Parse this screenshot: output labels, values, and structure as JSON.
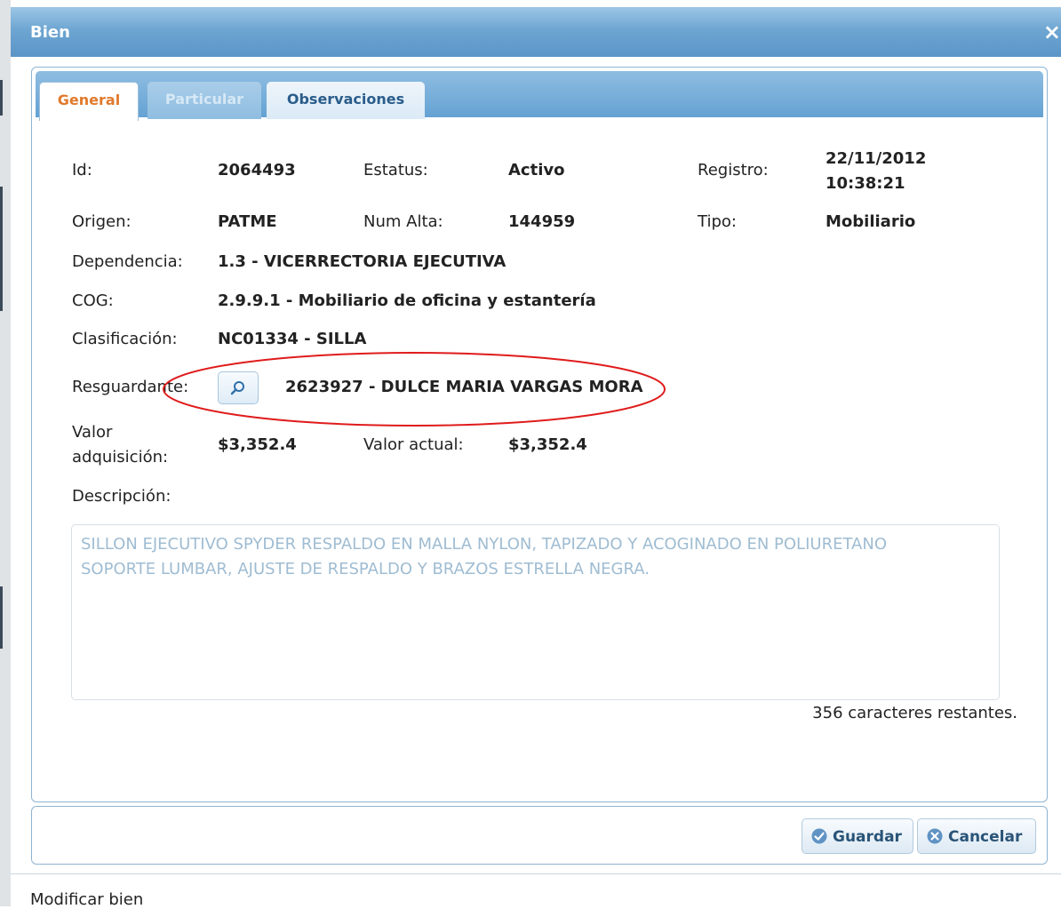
{
  "dialog": {
    "title": "Bien",
    "close_symbol": "×"
  },
  "tabs": [
    {
      "label": "General",
      "active": true
    },
    {
      "label": "Particular",
      "active": false
    },
    {
      "label": "Observaciones",
      "active": false
    }
  ],
  "fields": {
    "id": {
      "label": "Id:",
      "value": "2064493"
    },
    "estatus": {
      "label": "Estatus:",
      "value": "Activo"
    },
    "registro": {
      "label": "Registro:",
      "date": "22/11/2012",
      "time": "10:38:21"
    },
    "origen": {
      "label": "Origen:",
      "value": "PATME"
    },
    "num_alta": {
      "label": "Num Alta:",
      "value": "144959"
    },
    "tipo": {
      "label": "Tipo:",
      "value": "Mobiliario"
    },
    "dependencia": {
      "label": "Dependencia:",
      "value": "1.3 - VICERRECTORIA EJECUTIVA"
    },
    "cog": {
      "label": "COG:",
      "value": "2.9.9.1 - Mobiliario de oficina y estantería"
    },
    "clasificacion": {
      "label": "Clasificación:",
      "value": "NC01334 - SILLA"
    },
    "resguardante": {
      "label": "Resguardante:",
      "value": "2623927 - DULCE MARIA VARGAS MORA"
    },
    "valor_adquisicion": {
      "label_line1": "Valor",
      "label_line2": "adquisición:",
      "value": "$3,352.4"
    },
    "valor_actual": {
      "label": "Valor actual:",
      "value": "$3,352.4"
    },
    "descripcion": {
      "label": "Descripción:",
      "line1": "SILLON EJECUTIVO SPYDER RESPALDO EN MALLA NYLON, TAPIZADO Y ACOGINADO EN POLIURETANO",
      "line2": "SOPORTE LUMBAR, AJUSTE DE RESPALDO Y BRAZOS ESTRELLA NEGRA.",
      "remaining": "356 caracteres restantes."
    }
  },
  "buttons": {
    "save": "Guardar",
    "cancel": "Cancelar"
  },
  "status_text": "Modificar bien",
  "colors": {
    "title_bar": "#6ea6d2",
    "active_tab_text": "#e07a2c",
    "annotation_ellipse": "#e01b1b"
  }
}
